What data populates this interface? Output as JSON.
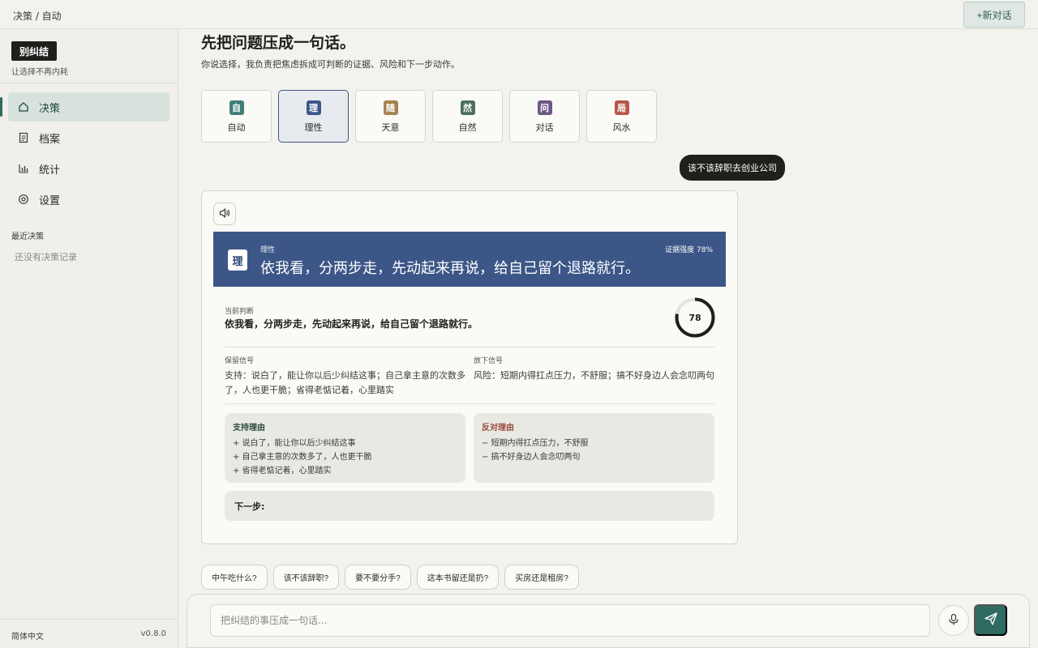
{
  "topbar": {
    "breadcrumb": "决策 / 自动",
    "new_chat_label": "+新对话"
  },
  "sidebar": {
    "brand": "别纠结",
    "tagline": "让选择不再内耗",
    "items": [
      {
        "label": "决策",
        "icon": "home-icon",
        "active": true
      },
      {
        "label": "档案",
        "icon": "document-icon",
        "active": false
      },
      {
        "label": "统计",
        "icon": "bar-chart-icon",
        "active": false
      },
      {
        "label": "设置",
        "icon": "gear-icon",
        "active": false
      }
    ],
    "recent_title": "最近决策",
    "recent_empty": "还没有决策记录",
    "language": "简体中文",
    "version": "v0.8.0"
  },
  "main": {
    "title": "先把问题压成一句话。",
    "subtitle": "你说选择，我负责把焦虑拆成可判断的证据、风险和下一步动作。",
    "modes": [
      {
        "glyph": "自",
        "label": "自动",
        "color": "#3f7f77",
        "active": false
      },
      {
        "glyph": "理",
        "label": "理性",
        "color": "#3c5687",
        "active": true
      },
      {
        "glyph": "随",
        "label": "天意",
        "color": "#a6824f",
        "active": false
      },
      {
        "glyph": "然",
        "label": "自然",
        "color": "#4f6f58",
        "active": false
      },
      {
        "glyph": "问",
        "label": "对话",
        "color": "#6c5785",
        "active": false
      },
      {
        "glyph": "局",
        "label": "风水",
        "color": "#b8574a",
        "active": false
      }
    ],
    "user_message": "该不该辞职去创业公司"
  },
  "answer": {
    "banner_glyph": "理",
    "banner_mode": "理性",
    "banner_strength": "证据强度 78%",
    "banner_text": "依我看，分两步走，先动起来再说，给自己留个退路就行。",
    "current_label": "当前判断",
    "current_text": "依我看，分两步走，先动起来再说，给自己留个退路就行。",
    "score": 78,
    "keep_label": "保留信号",
    "keep_text": "支持：说白了，能让你以后少纠结这事；自己拿主意的次数多了，人也更干脆；省得老惦记着，心里踏实",
    "drop_label": "放下信号",
    "drop_text": "风险：短期内得扛点压力，不舒服；搞不好身边人会念叨两句",
    "pros_title": "支持理由",
    "pros": [
      "+ 说白了，能让你以后少纠结这事",
      "+ 自己拿主意的次数多了，人也更干脆",
      "+ 省得老惦记着，心里踏实"
    ],
    "cons_title": "反对理由",
    "cons": [
      "− 短期内得扛点压力，不舒服",
      "− 搞不好身边人会念叨两句"
    ],
    "next_step_label": "下一步:",
    "colors": {
      "banner": "#3c5687",
      "pros_title": "#2b4a3e",
      "cons_title": "#9b4a3e",
      "pros_marker": "#2f5d55",
      "cons_marker": "#b8574a"
    }
  },
  "suggestions": [
    "中午吃什么?",
    "该不该辞职?",
    "要不要分手?",
    "这本书留还是扔?",
    "买房还是租房?"
  ],
  "composer": {
    "placeholder": "把纠结的事压成一句话...",
    "value": ""
  }
}
